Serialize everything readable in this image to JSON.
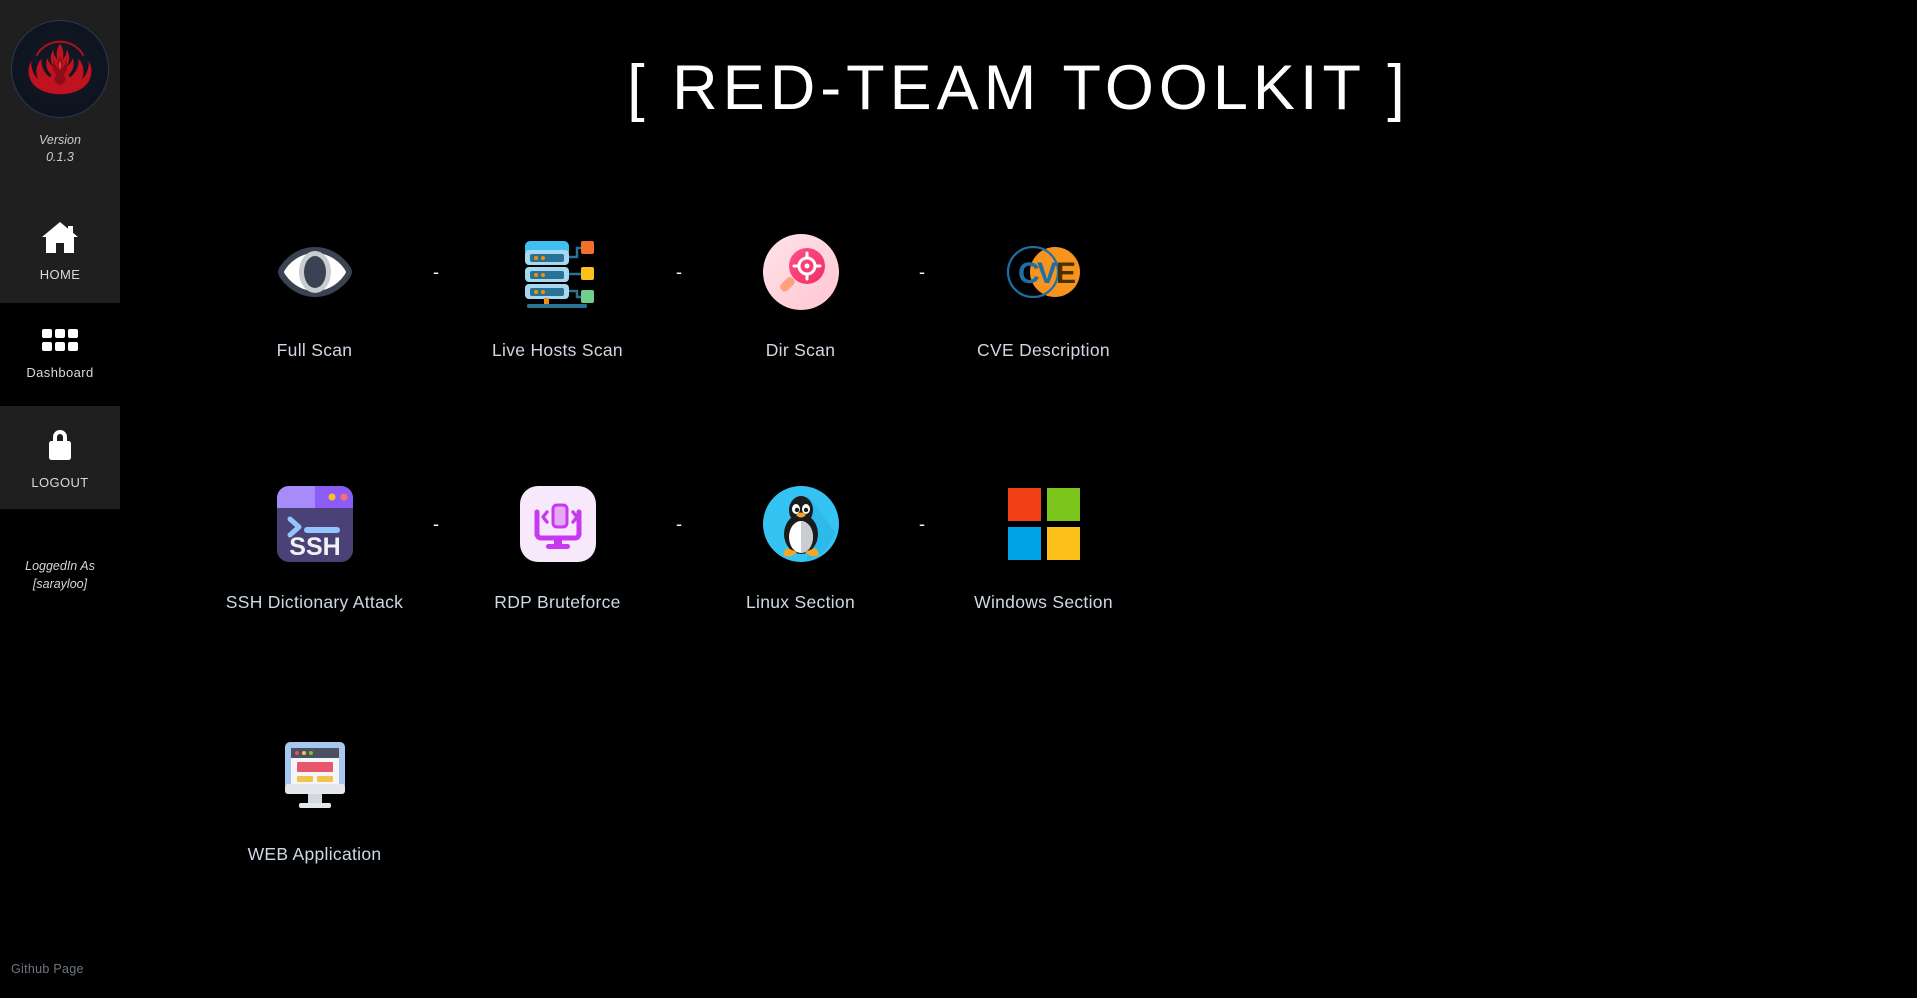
{
  "sidebar": {
    "logo_alt": "team-valor-phoenix-logo",
    "version_label": "Version",
    "version_number": "0.1.3",
    "nav": [
      {
        "id": "home",
        "label": "HOME",
        "icon": "home-icon"
      },
      {
        "id": "dashboard",
        "label": "Dashboard",
        "icon": "grid-icon"
      },
      {
        "id": "logout",
        "label": "LOGOUT",
        "icon": "lock-icon"
      }
    ],
    "loggedin_label": "LoggedIn As",
    "loggedin_user": "[sarayloo]",
    "github_link": "Github Page"
  },
  "main": {
    "title": "[ RED-TEAM TOOLKIT ]",
    "separator": "-",
    "rows": [
      [
        {
          "id": "full-scan",
          "label": "Full Scan",
          "icon": "eye-icon"
        },
        {
          "id": "live-hosts-scan",
          "label": "Live Hosts Scan",
          "icon": "server-network-icon"
        },
        {
          "id": "dir-scan",
          "label": "Dir Scan",
          "icon": "magnifier-target-icon"
        },
        {
          "id": "cve-description",
          "label": "CVE Description",
          "icon": "cve-logo-icon"
        }
      ],
      [
        {
          "id": "ssh-dictionary-attack",
          "label": "SSH Dictionary Attack",
          "icon": "ssh-terminal-icon"
        },
        {
          "id": "rdp-bruteforce",
          "label": "RDP Bruteforce",
          "icon": "rdp-monitor-icon"
        },
        {
          "id": "linux-section",
          "label": "Linux Section",
          "icon": "linux-penguin-icon"
        },
        {
          "id": "windows-section",
          "label": "Windows Section",
          "icon": "windows-logo-icon"
        }
      ],
      [
        {
          "id": "web-application",
          "label": "WEB Application",
          "icon": "web-browser-monitor-icon"
        }
      ]
    ]
  },
  "colors": {
    "background": "#000000",
    "sidebar_shaded": "#1f1f1f",
    "title_text": "#ffffff",
    "label_text": "#cfd8e3",
    "logo_red": "#c1121f",
    "muted_link": "#6f7681"
  }
}
